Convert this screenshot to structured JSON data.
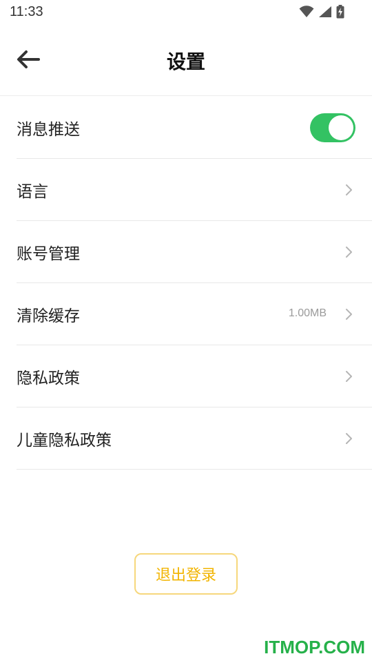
{
  "status_bar": {
    "time": "11:33",
    "icons": [
      "wifi-icon",
      "signal-icon",
      "battery-charging-icon"
    ]
  },
  "header": {
    "title": "设置",
    "back_icon": "arrow-left-icon"
  },
  "settings": {
    "items": [
      {
        "label": "消息推送",
        "control": "toggle",
        "toggle_on": true
      },
      {
        "label": "语言",
        "control": "chevron"
      },
      {
        "label": "账号管理",
        "control": "chevron"
      },
      {
        "label": "清除缓存",
        "control": "chevron",
        "value": "1.00MB"
      },
      {
        "label": "隐私政策",
        "control": "chevron"
      },
      {
        "label": "儿童隐私政策",
        "control": "chevron"
      }
    ]
  },
  "logout": {
    "label": "退出登录"
  },
  "watermark": {
    "text": "ITMOP.COM"
  },
  "colors": {
    "toggle_on": "#33c263",
    "logout_text": "#f2b400",
    "logout_border": "#f6d77c",
    "watermark": "#26b14a"
  }
}
